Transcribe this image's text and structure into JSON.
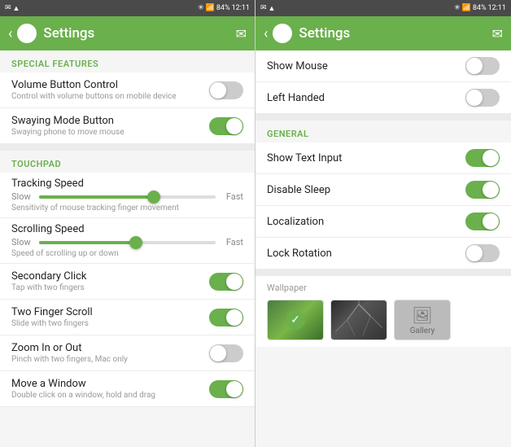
{
  "left_panel": {
    "status": {
      "time": "12:11",
      "battery": "84%"
    },
    "header": {
      "title": "Settings",
      "back_label": "‹"
    },
    "sections": [
      {
        "label": "SPECIAL FEATURES",
        "items": [
          {
            "title": "Volume Button Control",
            "subtitle": "Control with volume buttons on mobile device",
            "toggle": "off"
          },
          {
            "title": "Swaying Mode Button",
            "subtitle": "Swaying phone to move mouse",
            "toggle": "on"
          }
        ]
      },
      {
        "label": "TOUCHPAD",
        "sliders": [
          {
            "title": "Tracking Speed",
            "left_label": "Slow",
            "right_label": "Fast",
            "subtitle": "Sensitivity of mouse tracking finger movement",
            "fill_percent": 65
          },
          {
            "title": "Scrolling Speed",
            "left_label": "Slow",
            "right_label": "Fast",
            "subtitle": "Speed of scrolling up or down",
            "fill_percent": 55
          }
        ],
        "items": [
          {
            "title": "Secondary Click",
            "subtitle": "Tap with two fingers",
            "toggle": "on"
          },
          {
            "title": "Two Finger Scroll",
            "subtitle": "Slide with two fingers",
            "toggle": "on"
          },
          {
            "title": "Zoom In or Out",
            "subtitle": "Pinch with two fingers, Mac only",
            "toggle": "off"
          },
          {
            "title": "Move a Window",
            "subtitle": "Double click on a window, hold and drag",
            "toggle": "on"
          }
        ]
      }
    ]
  },
  "right_panel": {
    "status": {
      "time": "12:11",
      "battery": "84%"
    },
    "header": {
      "title": "Settings",
      "back_label": "‹"
    },
    "top_items": [
      {
        "title": "Show Mouse",
        "toggle": "off"
      },
      {
        "title": "Left Handed",
        "toggle": "off"
      }
    ],
    "general_label": "GENERAL",
    "general_items": [
      {
        "title": "Show Text Input",
        "toggle": "on"
      },
      {
        "title": "Disable Sleep",
        "toggle": "on"
      },
      {
        "title": "Localization",
        "toggle": "on"
      },
      {
        "title": "Lock Rotation",
        "toggle": "off"
      }
    ],
    "wallpaper": {
      "label": "Wallpaper",
      "gallery_label": "Gallery"
    }
  },
  "icons": {
    "back": "‹",
    "mail": "✉",
    "check": "✓"
  }
}
